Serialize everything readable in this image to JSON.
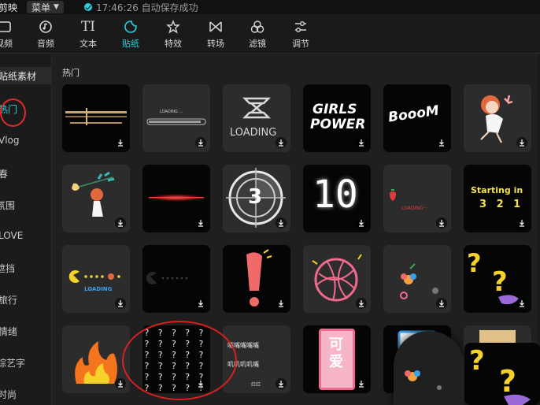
{
  "app": {
    "title": "剪映",
    "menu_label": "菜单",
    "save_status": "17:46:26 自动保存成功"
  },
  "colors": {
    "accent": "#2ad1e2",
    "annotation_red": "#e02a2a",
    "background": "#1f1f1f"
  },
  "toolbar": {
    "items": [
      {
        "label": "视频",
        "icon": "video-icon"
      },
      {
        "label": "音频",
        "icon": "audio-icon"
      },
      {
        "label": "文本",
        "icon": "text-icon"
      },
      {
        "label": "贴纸",
        "icon": "sticker-icon",
        "active": true
      },
      {
        "label": "特效",
        "icon": "effects-icon"
      },
      {
        "label": "转场",
        "icon": "transition-icon"
      },
      {
        "label": "滤镜",
        "icon": "filter-icon"
      },
      {
        "label": "调节",
        "icon": "adjust-icon"
      }
    ]
  },
  "sidebar": {
    "header": "贴纸素材",
    "items": [
      {
        "label": "热门",
        "active": true
      },
      {
        "label": "Vlog"
      },
      {
        "label": "春"
      },
      {
        "label": "氛围"
      },
      {
        "label": "LOVE"
      },
      {
        "label": "遮挡"
      },
      {
        "label": "旅行"
      },
      {
        "label": "情绪"
      },
      {
        "label": "综艺字"
      },
      {
        "label": "时尚"
      }
    ]
  },
  "main": {
    "section_title": "热门",
    "stickers": {
      "r1c2_text": "LOADING ...",
      "r1c3_text": "LOADING",
      "r1c4_line1": "GIRLS",
      "r1c4_line2": "POWER",
      "r1c5_text": "BoooM",
      "r2c3_text": "3",
      "r2c4_text": "10",
      "r2c5_text": "LOADING···",
      "r2c6_line1": "Starting in",
      "r2c6_line2": "3 2 1",
      "r3c1_text": "LOADING",
      "r4c2_text": "? ? ? ? ? ?\n? ? ? ? ? ?\n? ? ? ? ? ?\n? ? ? ? ? ?\n? ? ? ? ? ?\n? ? ? ? ? ?",
      "r4c3_text": "嘴嘴嘴嘴嘴",
      "r4c3_text2": "叽叽叽叽嘴",
      "r4c3_text3": "红红",
      "r4c4_text": "可爱"
    }
  }
}
